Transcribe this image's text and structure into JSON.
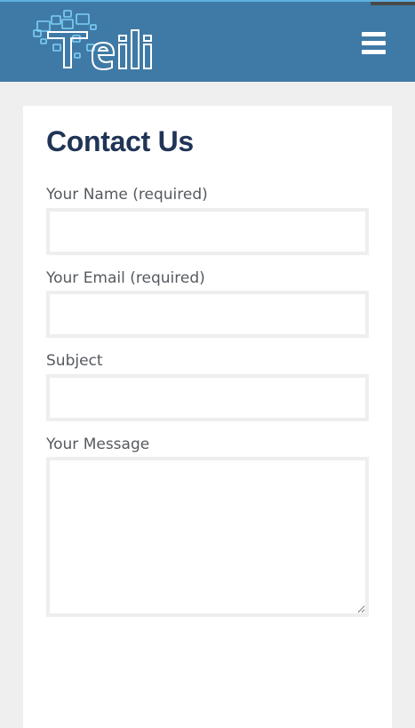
{
  "header": {
    "logo_text": "Teili",
    "menu_icon": "hamburger-menu-icon",
    "background_color": "#3f7aa6"
  },
  "main": {
    "title": "Contact Us",
    "fields": [
      {
        "label": "Your Name (required)",
        "value": "",
        "placeholder": ""
      },
      {
        "label": "Your Email (required)",
        "value": "",
        "placeholder": ""
      },
      {
        "label": "Subject",
        "value": "",
        "placeholder": ""
      },
      {
        "label": "Your Message",
        "value": "",
        "placeholder": ""
      }
    ]
  },
  "colors": {
    "title": "#1f3456",
    "label": "#555a60",
    "input_border": "#eeeeee",
    "page_background": "#efefef"
  }
}
